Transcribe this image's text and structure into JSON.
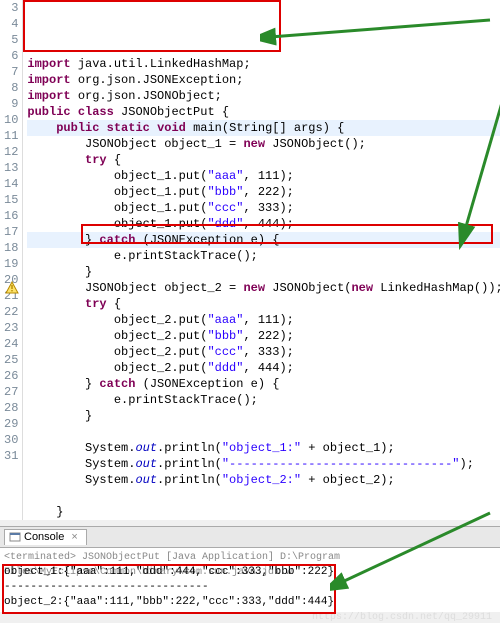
{
  "lines": [
    {
      "n": "3",
      "segs": [
        {
          "t": "import",
          "c": "kw"
        },
        {
          "t": " java.util.LinkedHashMap;",
          "c": "plain"
        }
      ]
    },
    {
      "n": "4",
      "segs": [
        {
          "t": "import",
          "c": "kw"
        },
        {
          "t": " org.json.JSONException;",
          "c": "plain"
        }
      ]
    },
    {
      "n": "5",
      "segs": [
        {
          "t": "import",
          "c": "kw"
        },
        {
          "t": " org.json.JSONObject;",
          "c": "plain"
        }
      ]
    },
    {
      "n": "6",
      "segs": [
        {
          "t": "public",
          "c": "kw"
        },
        {
          "t": " ",
          "c": "plain"
        },
        {
          "t": "class",
          "c": "kw"
        },
        {
          "t": " JSONObjectPut {",
          "c": "plain"
        }
      ]
    },
    {
      "n": "7",
      "segs": [
        {
          "t": "    ",
          "c": "plain"
        },
        {
          "t": "public",
          "c": "kw"
        },
        {
          "t": " ",
          "c": "plain"
        },
        {
          "t": "static",
          "c": "kw"
        },
        {
          "t": " ",
          "c": "plain"
        },
        {
          "t": "void",
          "c": "kw"
        },
        {
          "t": " main(String[] args) {",
          "c": "plain"
        }
      ],
      "hl": true
    },
    {
      "n": "8",
      "segs": [
        {
          "t": "        JSONObject object_1 = ",
          "c": "plain"
        },
        {
          "t": "new",
          "c": "kw"
        },
        {
          "t": " JSONObject();",
          "c": "plain"
        }
      ]
    },
    {
      "n": "9",
      "segs": [
        {
          "t": "        ",
          "c": "plain"
        },
        {
          "t": "try",
          "c": "kw"
        },
        {
          "t": " {",
          "c": "plain"
        }
      ]
    },
    {
      "n": "10",
      "segs": [
        {
          "t": "            object_1.put(",
          "c": "plain"
        },
        {
          "t": "\"aaa\"",
          "c": "str"
        },
        {
          "t": ", 111);",
          "c": "plain"
        }
      ]
    },
    {
      "n": "11",
      "segs": [
        {
          "t": "            object_1.put(",
          "c": "plain"
        },
        {
          "t": "\"bbb\"",
          "c": "str"
        },
        {
          "t": ", 222);",
          "c": "plain"
        }
      ]
    },
    {
      "n": "12",
      "segs": [
        {
          "t": "            object_1.put(",
          "c": "plain"
        },
        {
          "t": "\"ccc\"",
          "c": "str"
        },
        {
          "t": ", 333);",
          "c": "plain"
        }
      ]
    },
    {
      "n": "13",
      "segs": [
        {
          "t": "            object_1.put(",
          "c": "plain"
        },
        {
          "t": "\"ddd\"",
          "c": "str"
        },
        {
          "t": ", 444);",
          "c": "plain"
        }
      ]
    },
    {
      "n": "14",
      "segs": [
        {
          "t": "        } ",
          "c": "plain"
        },
        {
          "t": "catch",
          "c": "kw"
        },
        {
          "t": " (JSONException e) {",
          "c": "plain"
        }
      ],
      "hl": true
    },
    {
      "n": "15",
      "segs": [
        {
          "t": "            e.printStackTrace();",
          "c": "plain"
        }
      ]
    },
    {
      "n": "16",
      "segs": [
        {
          "t": "        }",
          "c": "plain"
        }
      ]
    },
    {
      "n": "17",
      "segs": [
        {
          "t": "        JSONObject object_2 = ",
          "c": "plain"
        },
        {
          "t": "new",
          "c": "kw"
        },
        {
          "t": " JSONObject(",
          "c": "plain"
        },
        {
          "t": "new",
          "c": "kw"
        },
        {
          "t": " LinkedHashMap());",
          "c": "plain"
        }
      ],
      "marker": "warn"
    },
    {
      "n": "18",
      "segs": [
        {
          "t": "        ",
          "c": "plain"
        },
        {
          "t": "try",
          "c": "kw"
        },
        {
          "t": " {",
          "c": "plain"
        }
      ]
    },
    {
      "n": "19",
      "segs": [
        {
          "t": "            object_2.put(",
          "c": "plain"
        },
        {
          "t": "\"aaa\"",
          "c": "str"
        },
        {
          "t": ", 111);",
          "c": "plain"
        }
      ]
    },
    {
      "n": "20",
      "segs": [
        {
          "t": "            object_2.put(",
          "c": "plain"
        },
        {
          "t": "\"bbb\"",
          "c": "str"
        },
        {
          "t": ", 222);",
          "c": "plain"
        }
      ]
    },
    {
      "n": "21",
      "segs": [
        {
          "t": "            object_2.put(",
          "c": "plain"
        },
        {
          "t": "\"ccc\"",
          "c": "str"
        },
        {
          "t": ", 333);",
          "c": "plain"
        }
      ]
    },
    {
      "n": "22",
      "segs": [
        {
          "t": "            object_2.put(",
          "c": "plain"
        },
        {
          "t": "\"ddd\"",
          "c": "str"
        },
        {
          "t": ", 444);",
          "c": "plain"
        }
      ]
    },
    {
      "n": "23",
      "segs": [
        {
          "t": "        } ",
          "c": "plain"
        },
        {
          "t": "catch",
          "c": "kw"
        },
        {
          "t": " (JSONException e) {",
          "c": "plain"
        }
      ]
    },
    {
      "n": "24",
      "segs": [
        {
          "t": "            e.printStackTrace();",
          "c": "plain"
        }
      ]
    },
    {
      "n": "25",
      "segs": [
        {
          "t": "        }",
          "c": "plain"
        }
      ]
    },
    {
      "n": "26",
      "segs": [
        {
          "t": " ",
          "c": "plain"
        }
      ]
    },
    {
      "n": "27",
      "segs": [
        {
          "t": "        System.",
          "c": "plain"
        },
        {
          "t": "out",
          "c": "field"
        },
        {
          "t": ".println(",
          "c": "plain"
        },
        {
          "t": "\"object_1:\"",
          "c": "str"
        },
        {
          "t": " + object_1);",
          "c": "plain"
        }
      ]
    },
    {
      "n": "28",
      "segs": [
        {
          "t": "        System.",
          "c": "plain"
        },
        {
          "t": "out",
          "c": "field"
        },
        {
          "t": ".println(",
          "c": "plain"
        },
        {
          "t": "\"-------------------------------\"",
          "c": "str"
        },
        {
          "t": ");",
          "c": "plain"
        }
      ]
    },
    {
      "n": "29",
      "segs": [
        {
          "t": "        System.",
          "c": "plain"
        },
        {
          "t": "out",
          "c": "field"
        },
        {
          "t": ".println(",
          "c": "plain"
        },
        {
          "t": "\"object_2:\"",
          "c": "str"
        },
        {
          "t": " + object_2);",
          "c": "plain"
        }
      ]
    },
    {
      "n": "30",
      "segs": [
        {
          "t": " ",
          "c": "plain"
        }
      ]
    },
    {
      "n": "31",
      "segs": [
        {
          "t": "    }",
          "c": "plain"
        }
      ]
    }
  ],
  "console": {
    "tab_label": "Console",
    "terminated": "<terminated> JSONObjectPut [Java Application] D:\\Program Files\\MyEclipse\\Common\\binary\\com.sun.java.jdk.w",
    "out1": "object_1:{\"aaa\":111,\"ddd\":444,\"ccc\":333,\"bbb\":222}",
    "out2": "-------------------------------",
    "out3": "object_2:{\"aaa\":111,\"bbb\":222,\"ccc\":333,\"ddd\":444}"
  },
  "watermark": "https://blog.csdn.net/qq_29911"
}
